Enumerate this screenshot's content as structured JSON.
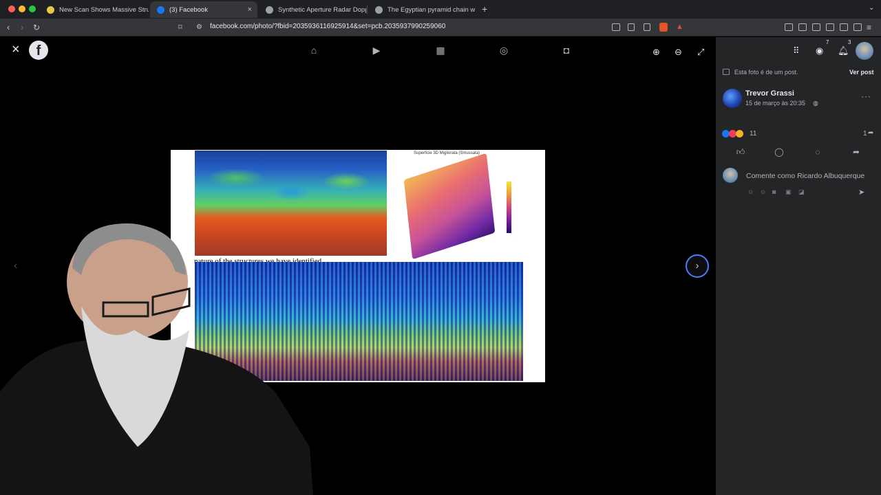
{
  "browser": {
    "tabs": [
      {
        "title": "New Scan Shows Massive Structu",
        "active": false
      },
      {
        "title": "(3) Facebook",
        "active": true
      },
      {
        "title": "Synthetic Aperture Radar Doppler",
        "active": false
      },
      {
        "title": "The Egyptian pyramid chain was t",
        "active": false
      }
    ],
    "new_tab": "+",
    "url": "facebook.com/photo/?fbid=2035936116925914&set=pcb.2035937990259060",
    "close_glyph": "×"
  },
  "viewer": {
    "messenger_badge": "7",
    "notifications_badge": "3",
    "photo": {
      "title": "Superficie 3D Migliorata (Smussata)",
      "caption": "nature of the structures we have identified."
    }
  },
  "sidebar": {
    "post_notice": "Esta foto é de um post.",
    "view_post": "Ver post",
    "author": "Trevor Grassi",
    "timestamp": "15 de março às 20:35",
    "reactions_count": "11",
    "shares_count": "1",
    "comment_placeholder": "Comente como Ricardo Albuquerque"
  },
  "colors": {
    "facebook_blue": "#1877f2",
    "sidebar_bg": "#242526",
    "focus_ring": "#4c7dff"
  }
}
